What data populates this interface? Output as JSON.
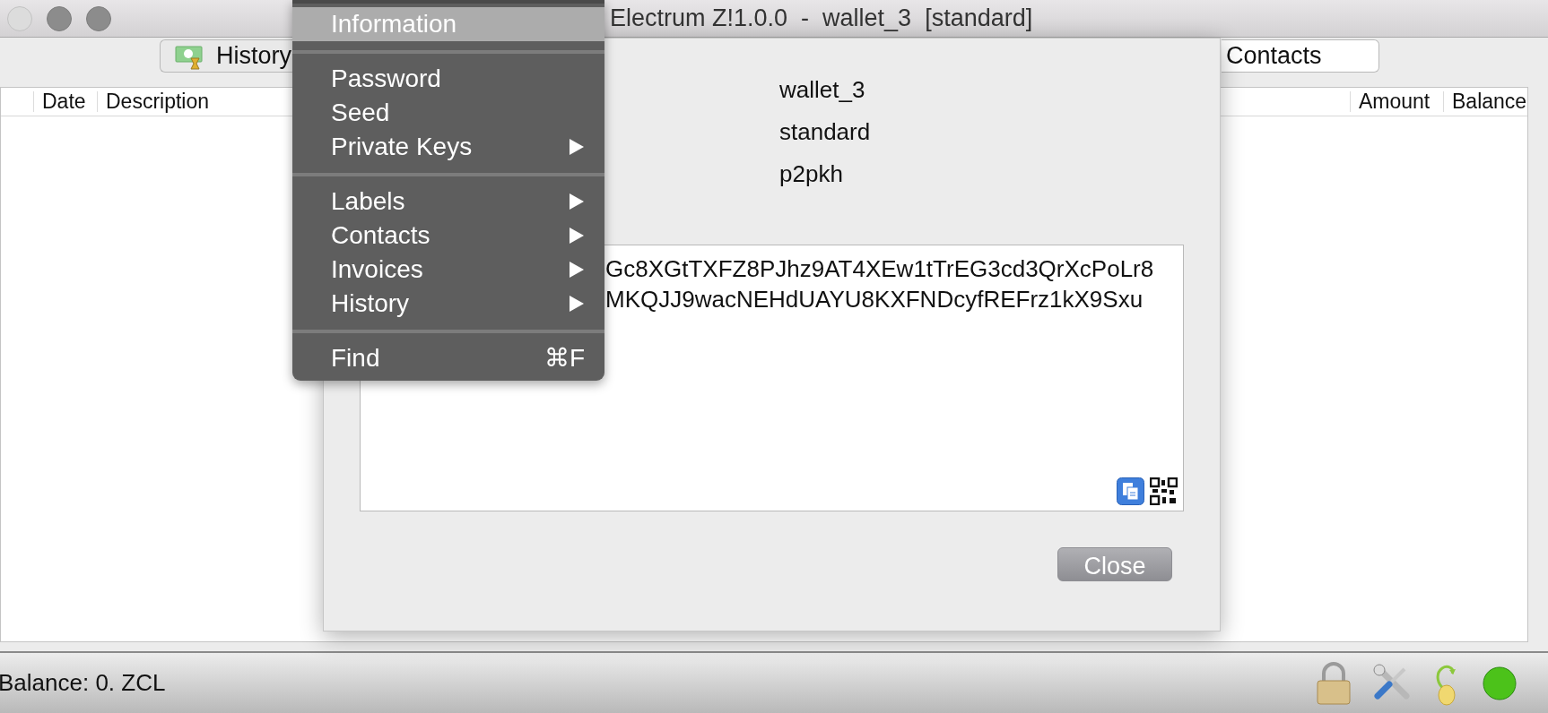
{
  "window": {
    "title": "Electrum Z!1.0.0  -  wallet_3  [standard]",
    "controls": [
      {
        "disabled": true
      },
      {
        "disabled": false
      },
      {
        "disabled": false
      }
    ]
  },
  "tabs": [
    {
      "label": "History",
      "kind": "icon"
    },
    {
      "label": "Contacts",
      "kind": "text"
    }
  ],
  "table": {
    "columns": [
      "Date",
      "Description",
      "Amount",
      "Balance"
    ]
  },
  "dialog": {
    "values": [
      "wallet_3",
      "standard",
      "p2pkh"
    ],
    "text_area": {
      "lines": [
        "Gc8XGtTXFZ8PJhz9AT4XEw1tTrEG3cd3QrXcPoLr8",
        "MKQJJ9wacNEHdUAYU8KXFNDcyfREFrz1kX9Sxu"
      ]
    },
    "close_button": "Close"
  },
  "menu": {
    "items": [
      {
        "kind": "item",
        "label": "Information",
        "selected": true,
        "submenu": false
      },
      {
        "kind": "separator"
      },
      {
        "kind": "item",
        "label": "Password",
        "selected": false,
        "submenu": false
      },
      {
        "kind": "item",
        "label": "Seed",
        "selected": false,
        "submenu": false
      },
      {
        "kind": "item",
        "label": "Private Keys",
        "selected": false,
        "submenu": true
      },
      {
        "kind": "separator"
      },
      {
        "kind": "item",
        "label": "Labels",
        "selected": false,
        "submenu": true
      },
      {
        "kind": "item",
        "label": "Contacts",
        "selected": false,
        "submenu": true
      },
      {
        "kind": "item",
        "label": "Invoices",
        "selected": false,
        "submenu": true
      },
      {
        "kind": "item",
        "label": "History",
        "selected": false,
        "submenu": true
      },
      {
        "kind": "separator"
      },
      {
        "kind": "item",
        "label": "Find",
        "selected": false,
        "submenu": false,
        "shortcut": "⌘F"
      }
    ]
  },
  "status_bar": {
    "balance": "Balance: 0. ZCL",
    "connected": true
  }
}
